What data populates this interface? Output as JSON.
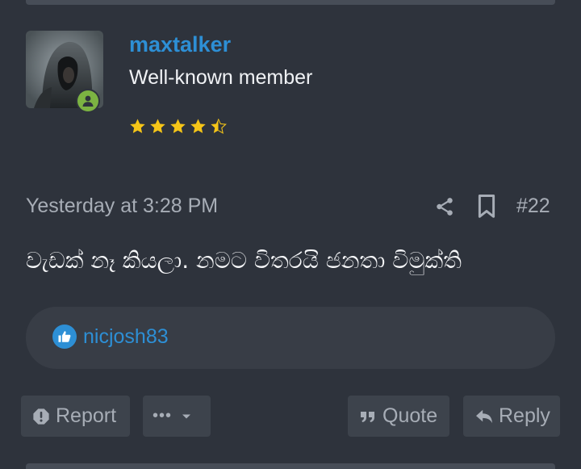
{
  "user": {
    "username": "maxtalker",
    "title": "Well-known member",
    "rating_stars": 4.5,
    "online": true
  },
  "post": {
    "date": "Yesterday at 3:28 PM",
    "number": "#22",
    "body": "වැඩක් නෑ කියලා. නමට විතරයි ජනතා විමුක්ති"
  },
  "reactions": {
    "user": "nicjosh83"
  },
  "actions": {
    "report": "Report",
    "more": "•••",
    "quote": "Quote",
    "reply": "Reply"
  },
  "colors": {
    "background": "#2e333c",
    "accent": "#2d8fd5",
    "online": "#7cb342",
    "star": "#f5c518"
  }
}
